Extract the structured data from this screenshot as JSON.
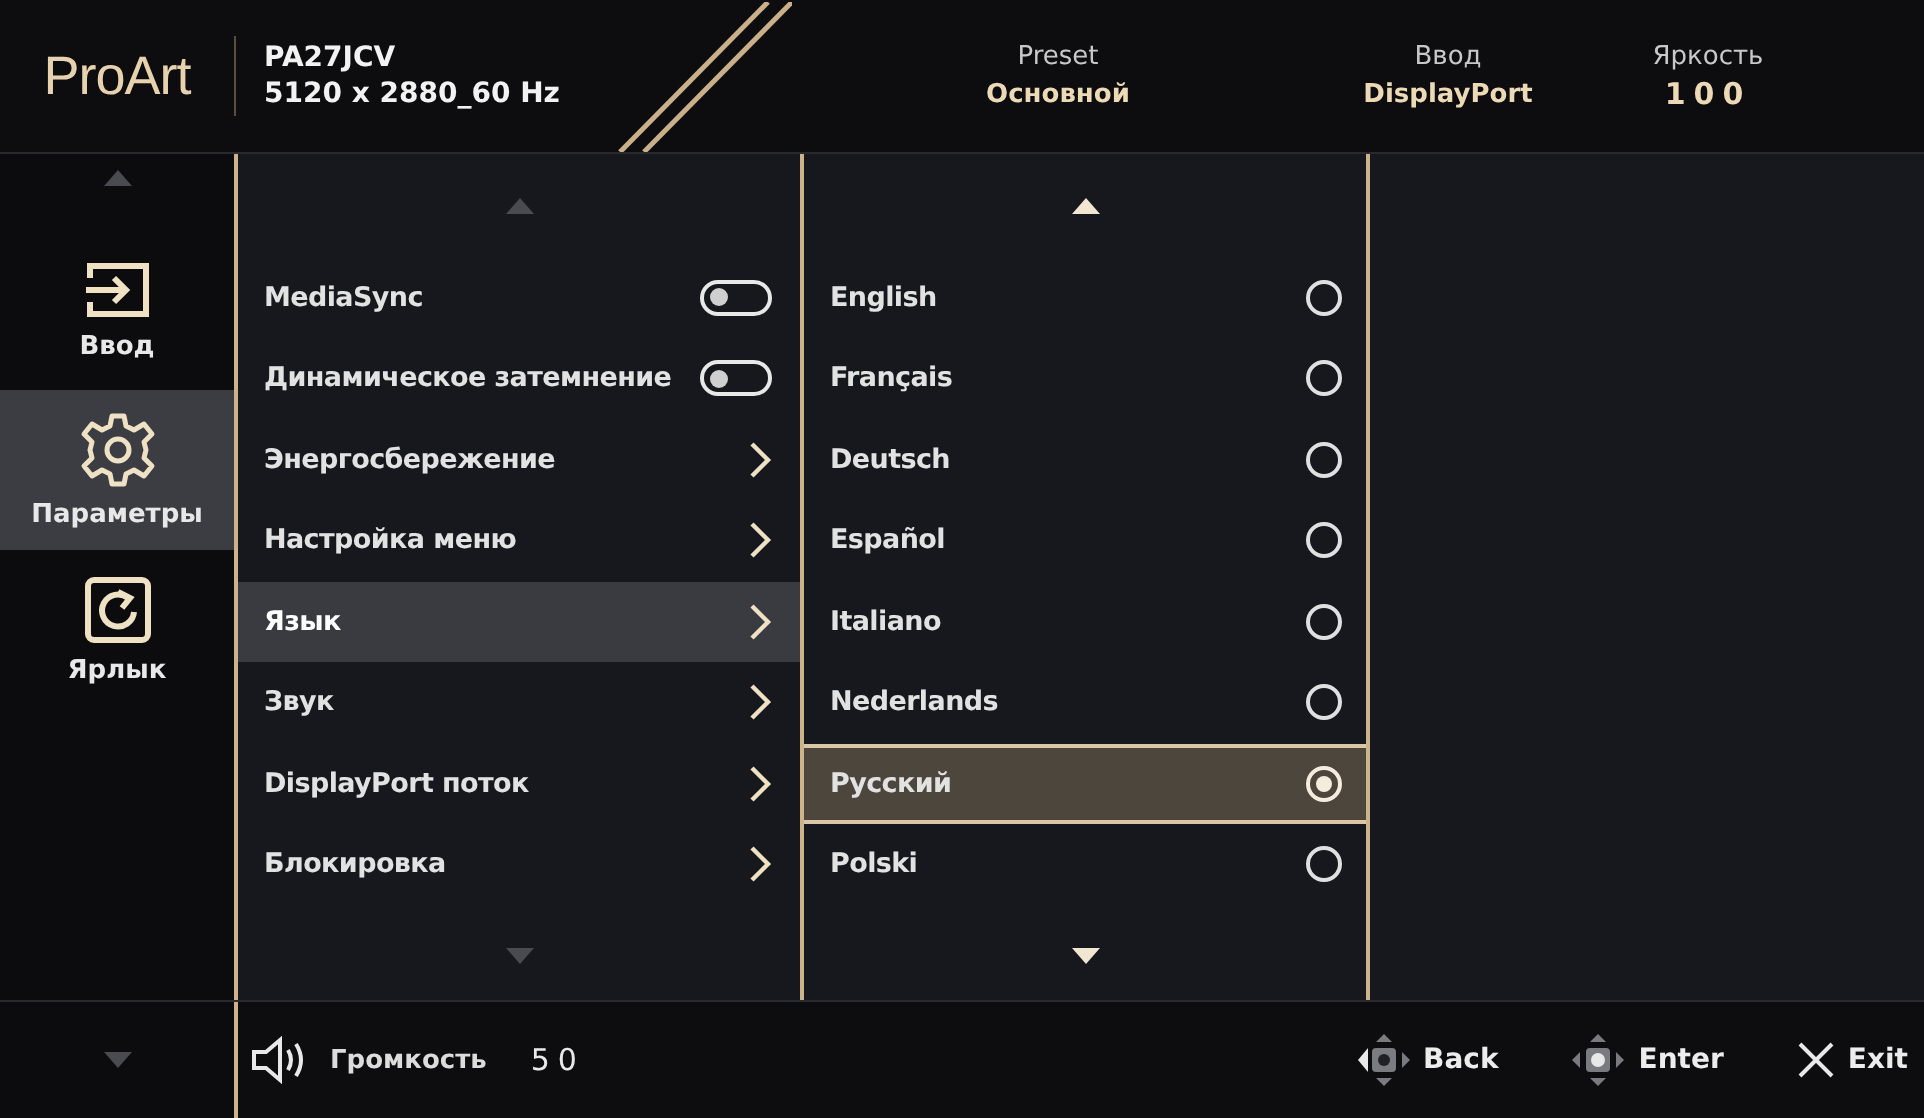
{
  "header": {
    "logo": "ProArt",
    "model": "PA27JCV",
    "resolution": "5120 x 2880_60 Hz",
    "status": [
      {
        "label": "Preset",
        "value": "Основной"
      },
      {
        "label": "Ввод",
        "value": "DisplayPort"
      },
      {
        "label": "Яркость",
        "value": "100"
      }
    ]
  },
  "sidebar": {
    "items": [
      {
        "kind": "input",
        "label": "Ввод",
        "selected": false
      },
      {
        "kind": "settings",
        "label": "Параметры",
        "selected": true
      },
      {
        "kind": "shortcut",
        "label": "Ярлык",
        "selected": false
      }
    ]
  },
  "menu": {
    "items": [
      {
        "label": "MediaSync",
        "kind": "toggle",
        "on": false,
        "selected": false
      },
      {
        "label": "Динамическое затемнение",
        "kind": "toggle",
        "on": false,
        "selected": false
      },
      {
        "label": "Энергосбережение",
        "kind": "submenu",
        "selected": false
      },
      {
        "label": "Настройка меню",
        "kind": "submenu",
        "selected": false
      },
      {
        "label": "Язык",
        "kind": "submenu",
        "selected": true
      },
      {
        "label": "Звук",
        "kind": "submenu",
        "selected": false
      },
      {
        "label": "DisplayPort поток",
        "kind": "submenu",
        "selected": false
      },
      {
        "label": "Блокировка",
        "kind": "submenu",
        "selected": false
      }
    ]
  },
  "languages": [
    {
      "label": "English",
      "selected": false
    },
    {
      "label": "Français",
      "selected": false
    },
    {
      "label": "Deutsch",
      "selected": false
    },
    {
      "label": "Español",
      "selected": false
    },
    {
      "label": "Italiano",
      "selected": false
    },
    {
      "label": "Nederlands",
      "selected": false
    },
    {
      "label": "Русский",
      "selected": true
    },
    {
      "label": "Polski",
      "selected": false
    }
  ],
  "footer": {
    "volume_label": "Громкость",
    "volume_value": "50",
    "actions": [
      {
        "kind": "back",
        "label": "Back"
      },
      {
        "kind": "enter",
        "label": "Enter"
      },
      {
        "kind": "exit",
        "label": "Exit"
      }
    ]
  }
}
